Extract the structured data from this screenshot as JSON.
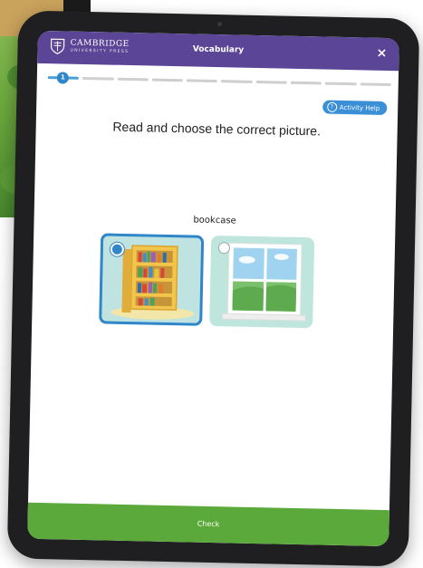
{
  "app": {
    "logo_brand": "CAMBRIDGE",
    "logo_sub": "UNIVERSITY PRESS",
    "title": "Vocabulary",
    "close_label": "×"
  },
  "progress": {
    "current": "1",
    "segments": 10
  },
  "activity_help": {
    "label": "Activity Help",
    "icon": "question-circle-icon"
  },
  "instruction": "Read and choose the correct picture.",
  "target_word": "bookcase",
  "options": [
    {
      "id": "bookcase",
      "picture": "bookcase-image",
      "selected": true
    },
    {
      "id": "window",
      "picture": "window-image",
      "selected": false
    }
  ],
  "check_button": "Check",
  "colors": {
    "header": "#5a4597",
    "accent": "#2f86c9",
    "check": "#5aa93a"
  }
}
